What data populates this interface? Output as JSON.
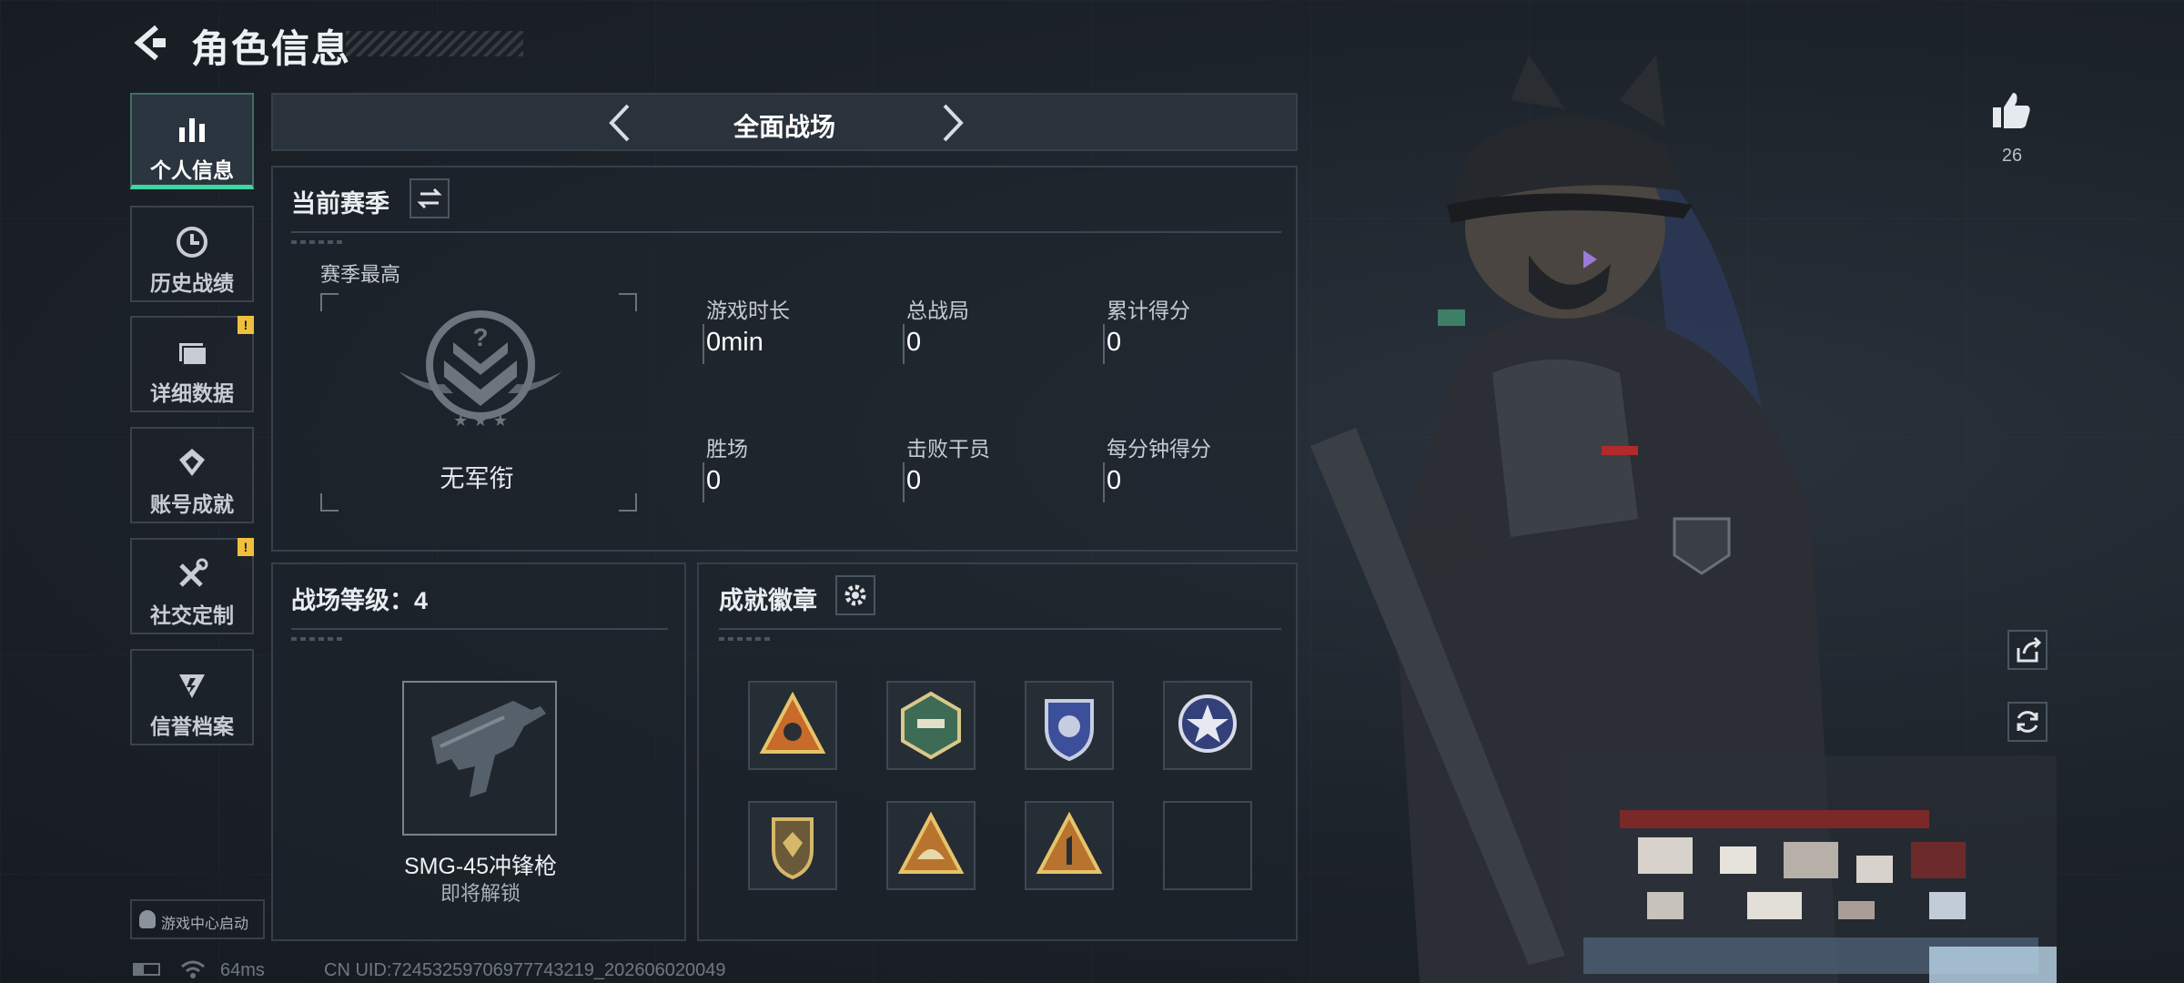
{
  "header": {
    "title": "角色信息"
  },
  "sidebar": {
    "items": [
      {
        "label": "个人信息",
        "icon": "bar-chart-icon",
        "active": true
      },
      {
        "label": "历史战绩",
        "icon": "history-clock-icon"
      },
      {
        "label": "详细数据",
        "icon": "folder-icon",
        "badge": "!"
      },
      {
        "label": "账号成就",
        "icon": "achievement-icon"
      },
      {
        "label": "社交定制",
        "icon": "tools-icon",
        "badge": "!"
      },
      {
        "label": "信誉档案",
        "icon": "credit-icon"
      }
    ],
    "launch_label": "游戏中心启动"
  },
  "mode_selector": {
    "label": "全面战场"
  },
  "season": {
    "title": "当前赛季",
    "best_label": "赛季最高",
    "rank_name": "无军衔",
    "stats": [
      {
        "label": "游戏时长",
        "value": "0min"
      },
      {
        "label": "总战局",
        "value": "0"
      },
      {
        "label": "累计得分",
        "value": "0"
      },
      {
        "label": "胜场",
        "value": "0"
      },
      {
        "label": "击败干员",
        "value": "0"
      },
      {
        "label": "每分钟得分",
        "value": "0"
      }
    ]
  },
  "battlefield_level": {
    "title": "战场等级：4",
    "weapon_name": "SMG-45冲锋枪",
    "weapon_status": "即将解锁"
  },
  "achievements": {
    "title": "成就徽章",
    "badges": [
      {
        "icon": "triangle-medal-icon"
      },
      {
        "icon": "hex-medal-icon"
      },
      {
        "icon": "shield-medal-icon"
      },
      {
        "icon": "star-round-medal-icon"
      },
      {
        "icon": "gem-shield-medal-icon"
      },
      {
        "icon": "triangle-helmet-medal-icon"
      },
      {
        "icon": "triangle-one-medal-icon"
      },
      {
        "icon": "empty-slot"
      }
    ]
  },
  "likes": {
    "count": "26"
  },
  "status": {
    "ping": "64ms",
    "uid": "CN UID:7245325970697774321​9_202606020049"
  },
  "colors": {
    "accent": "#3fd6a0",
    "warning": "#f0c03c",
    "background": "#1b2129"
  }
}
